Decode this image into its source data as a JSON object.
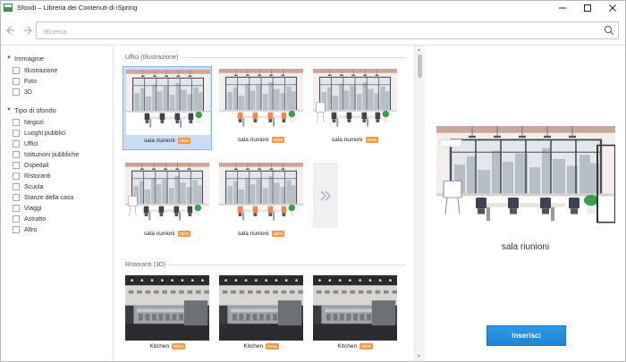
{
  "window": {
    "title": "Sfondi – Libreria dei Contenuti di iSpring",
    "controls": [
      "minimize",
      "maximize",
      "close"
    ]
  },
  "toolbar": {
    "back_icon": "arrow-left-icon",
    "forward_icon": "arrow-right-icon",
    "search_placeholder": "Ricerca",
    "search_value": ""
  },
  "sidebar": {
    "groups": [
      {
        "title": "Immagine",
        "expanded": true,
        "items": [
          {
            "label": "Illustrazione",
            "checked": false
          },
          {
            "label": "Foto",
            "checked": false
          },
          {
            "label": "3D",
            "checked": false
          }
        ]
      },
      {
        "title": "Tipo di sfondo",
        "expanded": true,
        "items": [
          {
            "label": "Negozi",
            "checked": false
          },
          {
            "label": "Luoghi pubblici",
            "checked": false
          },
          {
            "label": "Uffici",
            "checked": false
          },
          {
            "label": "Istituzioni pubbliche",
            "checked": false
          },
          {
            "label": "Ospedali",
            "checked": false
          },
          {
            "label": "Ristoranti",
            "checked": false
          },
          {
            "label": "Scuola",
            "checked": false
          },
          {
            "label": "Stanze della casa",
            "checked": false
          },
          {
            "label": "Viaggi",
            "checked": false
          },
          {
            "label": "Astratto",
            "checked": false
          },
          {
            "label": "Altro",
            "checked": false
          }
        ]
      }
    ]
  },
  "gallery": {
    "sections": [
      {
        "title": "Uffici (Illustrazione)",
        "tiles": [
          {
            "caption": "sala riunioni",
            "badge": "NEW",
            "selected": true
          },
          {
            "caption": "sala riunioni",
            "badge": "NEW",
            "selected": false
          },
          {
            "caption": "sala riunioni",
            "badge": "NEW",
            "selected": false
          },
          {
            "caption": "sala riunioni",
            "badge": "NEW",
            "selected": false
          },
          {
            "caption": "sala riunioni",
            "badge": "NEW",
            "selected": false
          }
        ],
        "more_icon": "double-chevron-right-icon"
      },
      {
        "title": "Ristoranti (3D)",
        "tiles": [
          {
            "caption": "Kitchen",
            "badge": "NEW",
            "selected": false
          },
          {
            "caption": "Kitchen",
            "badge": "NEW",
            "selected": false
          },
          {
            "caption": "Kitchen",
            "badge": "NEW",
            "selected": false
          }
        ]
      }
    ]
  },
  "preview": {
    "title": "sala riunioni",
    "insert_label": "Inserisci"
  },
  "colors": {
    "accent": "#1e85d4",
    "badge": "#f29a4a",
    "selection": "#c9def5"
  }
}
